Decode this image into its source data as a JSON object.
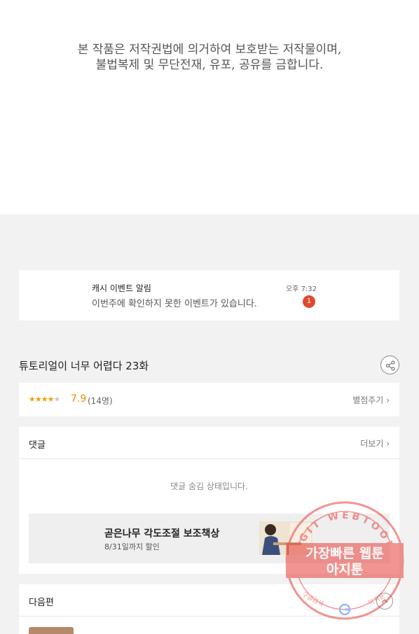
{
  "copyright": {
    "line1": "본 작품은 저작권법에 의거하여 보호받는 저작물이며,",
    "line2": "불법복제 및 무단전재, 유포, 공유를 금합니다."
  },
  "notification": {
    "title": "캐시 이벤트 알림",
    "message": "이번주에 확인하지 못한 이벤트가 있습니다.",
    "time": "오후 7:32",
    "badge_count": "1"
  },
  "episode": {
    "title": "튜토리얼이 너무 어렵다 23화",
    "share_icon": "share-icon"
  },
  "rating": {
    "stars_filled": 4,
    "stars_total": 5,
    "value": "7.9",
    "count": "(14명)",
    "rate_label": "별점주기"
  },
  "comments": {
    "title": "댓글",
    "more_label": "더보기",
    "hidden_message": "댓글 숨김 상태입니다."
  },
  "ad": {
    "title": "곧은나무 각도조절 보조책상",
    "subtitle": "8/31일까지 할인"
  },
  "next_episode": {
    "title": "다음편"
  },
  "watermark": {
    "arc_text": "AGIT WEBTOON",
    "line1": "가장빠른 웹툰",
    "line2": "아지툰",
    "bottom_left": "구글검색",
    "bottom_right": "아지툰",
    "accent_color": "#e8403a"
  }
}
